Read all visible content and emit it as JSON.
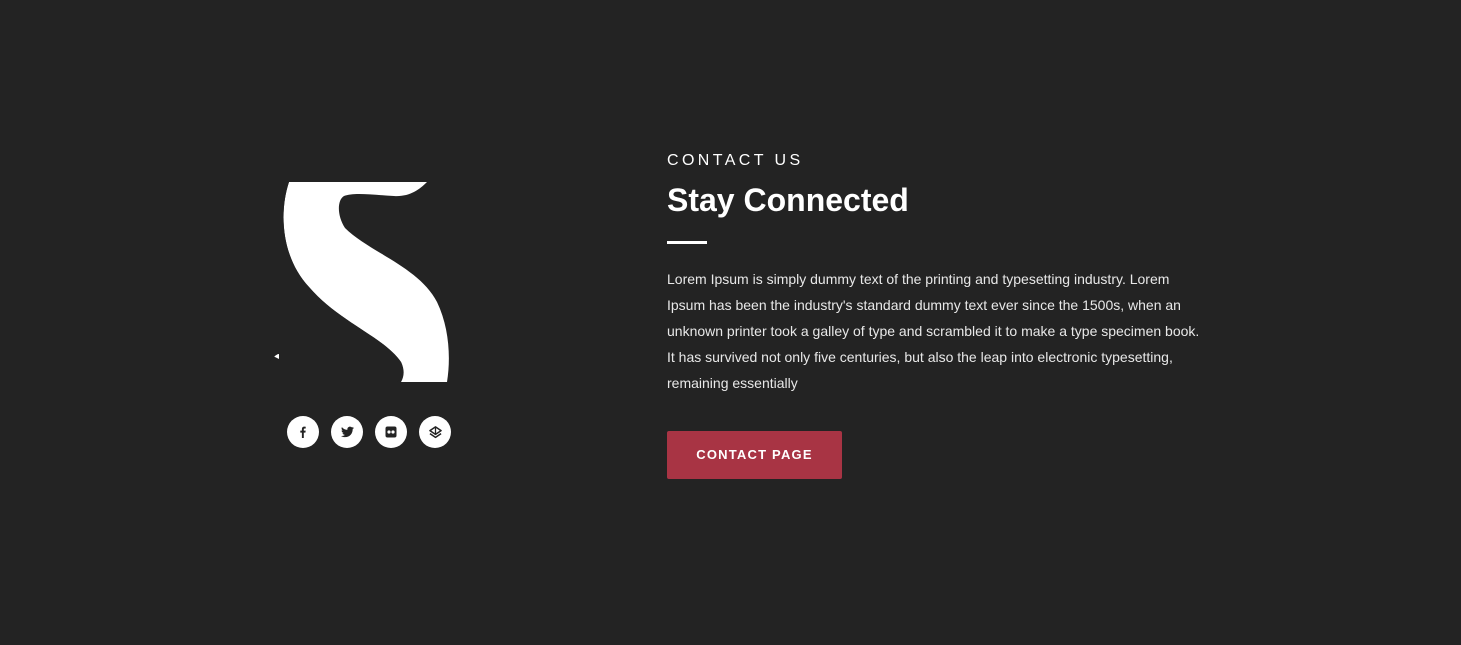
{
  "brand": {
    "logo_icon": "s-logo-icon"
  },
  "social": [
    {
      "icon": "facebook-icon"
    },
    {
      "icon": "twitter-icon"
    },
    {
      "icon": "flickr-icon"
    },
    {
      "icon": "codepen-icon"
    }
  ],
  "contact": {
    "eyebrow": "CONTACT US",
    "title": "Stay Connected",
    "body": "Lorem Ipsum is simply dummy text of the printing and typesetting industry. Lorem Ipsum has been the industry's standard dummy text ever since the 1500s, when an unknown printer took a galley of type and scrambled it to make a type specimen book. It has survived not only five centuries, but also the leap into electronic typesetting, remaining essentially",
    "button_label": "CONTACT PAGE"
  },
  "colors": {
    "background": "#232323",
    "accent": "#a83444",
    "text": "#ffffff"
  }
}
